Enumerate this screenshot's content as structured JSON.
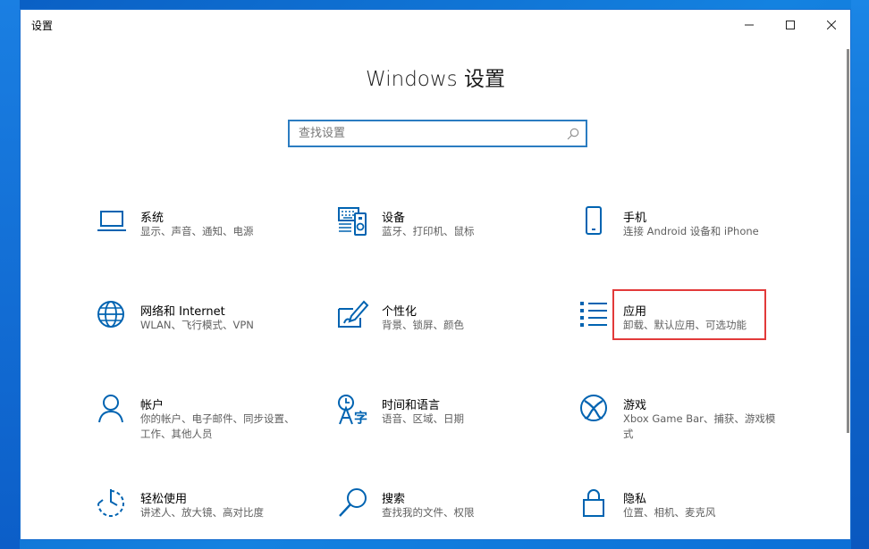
{
  "window": {
    "title": "设置",
    "heading": "Windows 设置",
    "controls": {
      "minimize": "—",
      "maximize": "☐",
      "close": "✕"
    }
  },
  "search": {
    "placeholder": "查找设置"
  },
  "tiles": [
    {
      "title": "系统",
      "desc": "显示、声音、通知、电源",
      "icon": "laptop-icon"
    },
    {
      "title": "设备",
      "desc": "蓝牙、打印机、鼠标",
      "icon": "keyboard-icon"
    },
    {
      "title": "手机",
      "desc": "连接 Android 设备和 iPhone",
      "icon": "phone-icon"
    },
    {
      "title": "网络和 Internet",
      "desc": "WLAN、飞行模式、VPN",
      "icon": "globe-icon"
    },
    {
      "title": "个性化",
      "desc": "背景、锁屏、颜色",
      "icon": "paintbrush-icon"
    },
    {
      "title": "应用",
      "desc": "卸载、默认应用、可选功能",
      "icon": "apps-list-icon"
    },
    {
      "title": "帐户",
      "desc": "你的帐户、电子邮件、同步设置、工作、其他人员",
      "icon": "person-icon"
    },
    {
      "title": "时间和语言",
      "desc": "语音、区域、日期",
      "icon": "language-icon"
    },
    {
      "title": "游戏",
      "desc": "Xbox Game Bar、捕获、游戏模式",
      "icon": "xbox-icon"
    },
    {
      "title": "轻松使用",
      "desc": "讲述人、放大镜、高对比度",
      "icon": "ease-of-access-icon"
    },
    {
      "title": "搜索",
      "desc": "查找我的文件、权限",
      "icon": "magnifier-icon"
    },
    {
      "title": "隐私",
      "desc": "位置、相机、麦克风",
      "icon": "lock-icon"
    }
  ],
  "colors": {
    "accent": "#0063b1",
    "highlight": "#e23a3a"
  }
}
